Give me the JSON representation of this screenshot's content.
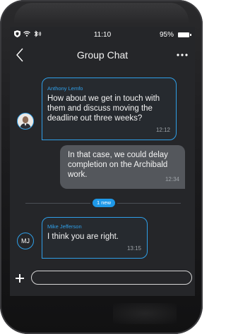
{
  "status_bar": {
    "time": "11:10",
    "battery": "95%"
  },
  "header": {
    "title": "Group Chat",
    "back_label": "<",
    "more_label": "•••"
  },
  "messages": [
    {
      "sender": "Anthony Lemfo",
      "text": "How about we get in touch with them and discuss moving the deadline out three weeks?",
      "time": "12:12"
    },
    {
      "text": "In that case, we could delay completion on the Archibald work.",
      "time": "12:34"
    },
    {
      "sender": "Mike Jefferson",
      "initials": "MJ",
      "text": "I think you are right.",
      "time": "13:15"
    }
  ],
  "new_divider": {
    "label": "1 new"
  },
  "composer": {
    "plus_label": "+",
    "placeholder": ""
  },
  "colors": {
    "accent": "#2f9fe8",
    "screen_bg": "#252629",
    "outgoing_bubble": "#54575c"
  }
}
